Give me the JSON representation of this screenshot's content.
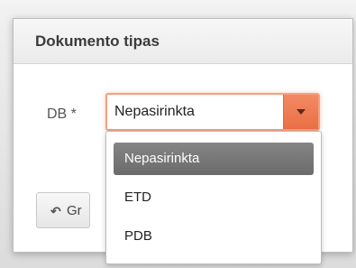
{
  "dialog": {
    "title": "Dokumento tipas"
  },
  "form": {
    "db_label": "DB *",
    "db_select": {
      "value": "Nepasirinkta",
      "options": [
        "Nepasirinkta",
        "ETD",
        "PDB"
      ],
      "highlighted_index": 0
    }
  },
  "back_button": {
    "icon": "reply-arrow-icon",
    "label": "Gr"
  },
  "colors": {
    "accent": "#e9784e",
    "focus_border": "#f3a07f",
    "highlight": "#7a7a7a"
  }
}
